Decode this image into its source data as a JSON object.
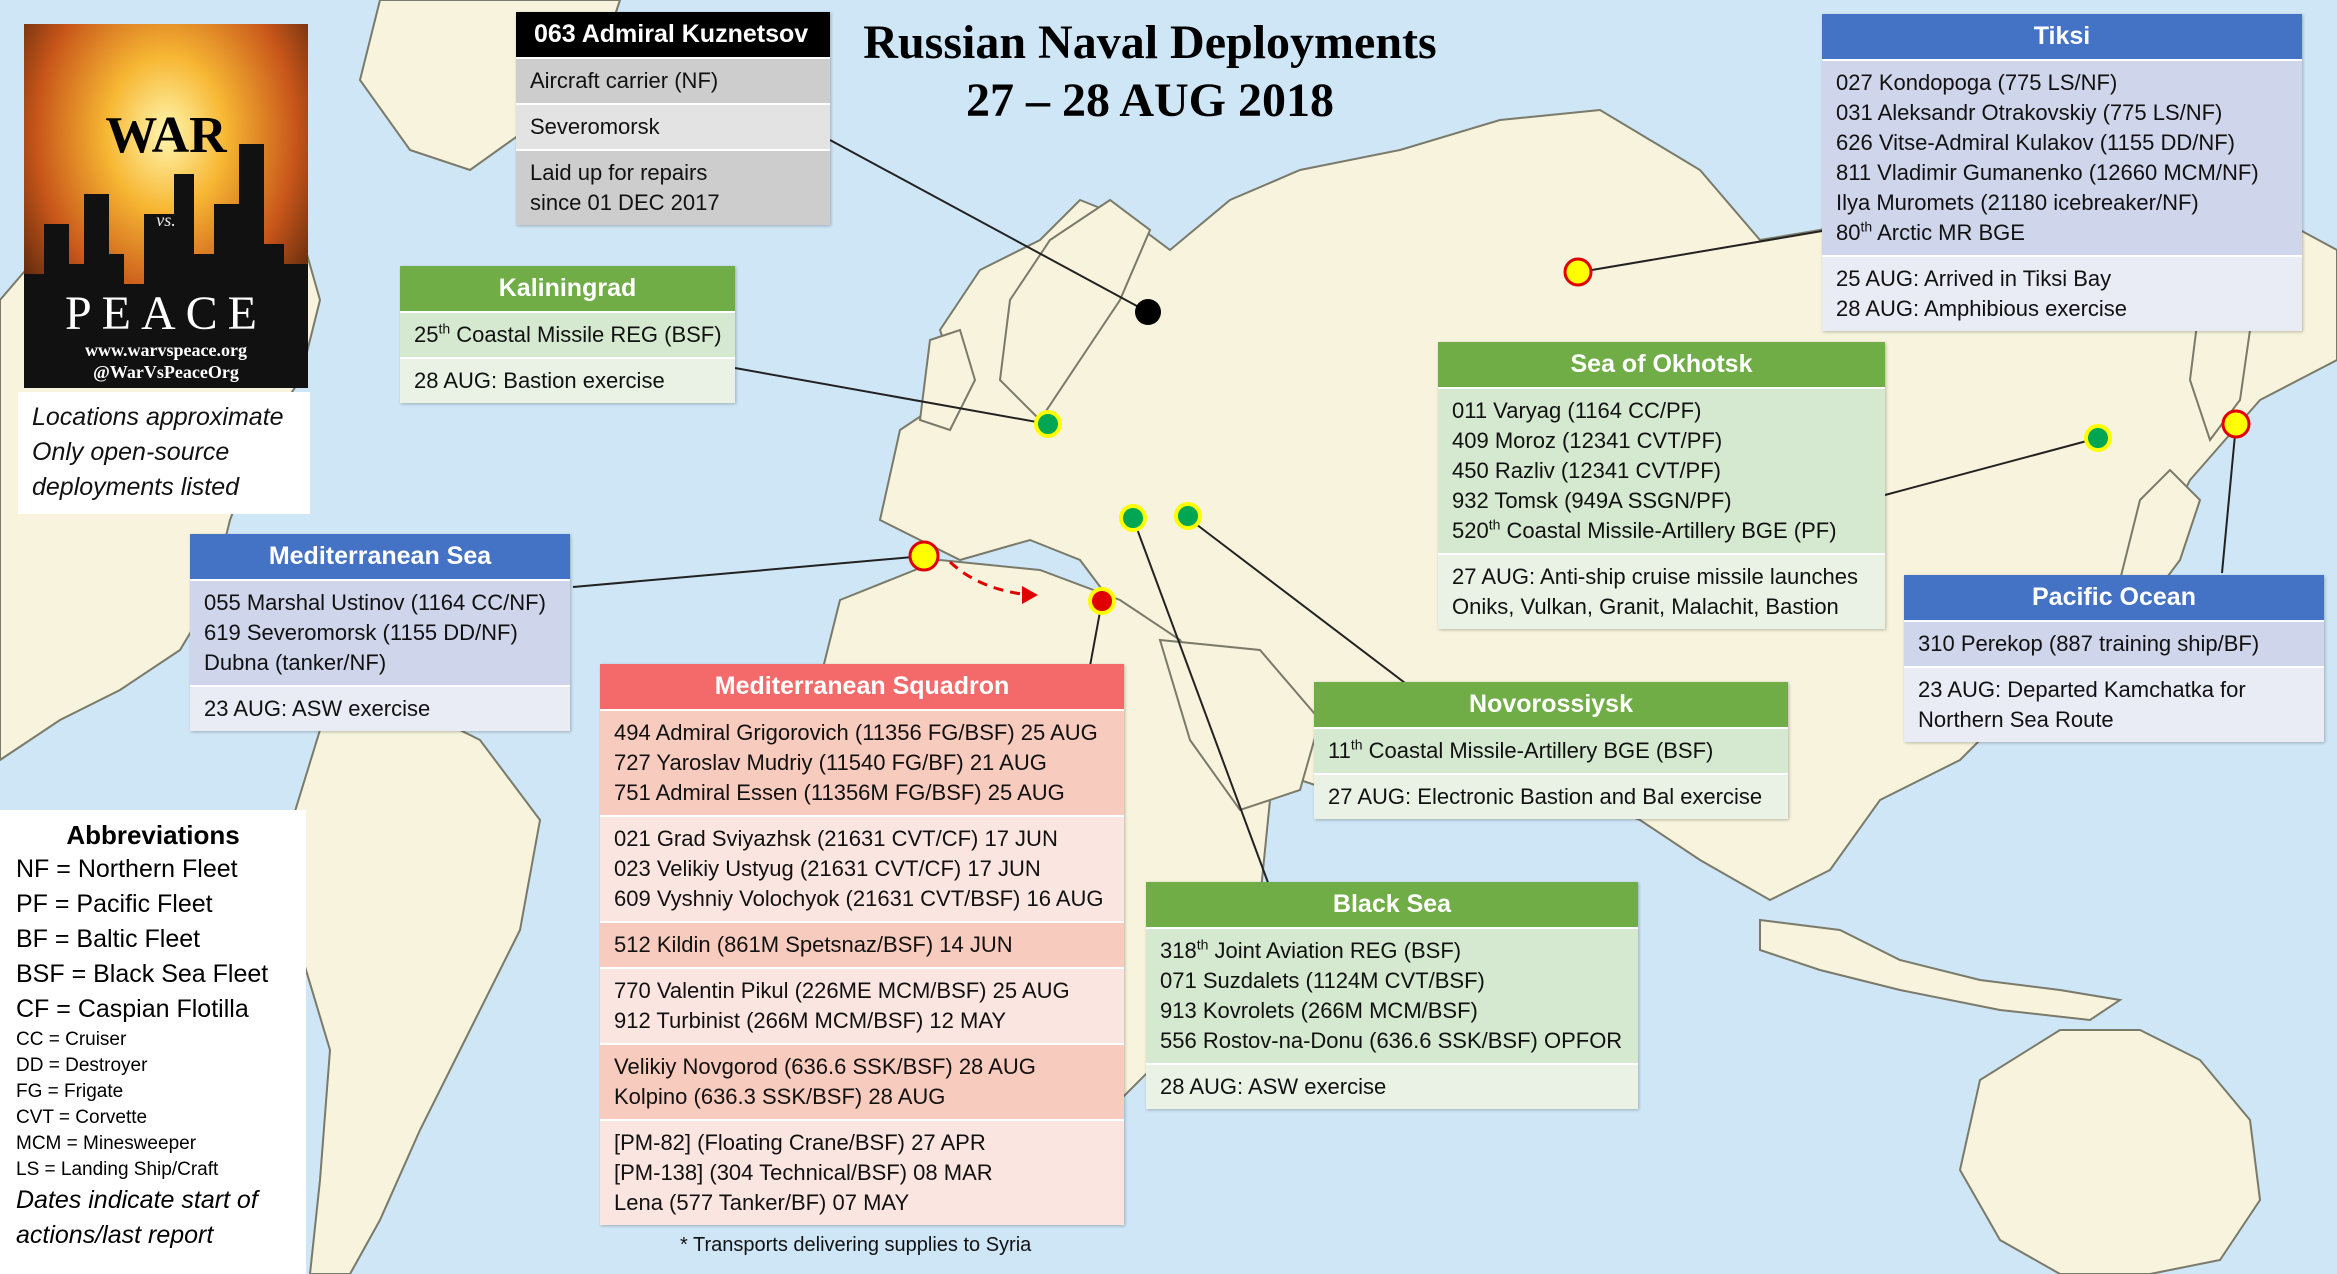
{
  "title": {
    "line1": "Russian Naval Deployments",
    "line2": "27 – 28 AUG 2018"
  },
  "logo": {
    "top_word": "WAR",
    "mid_word": "vs.",
    "bottom_word": "PEACE",
    "url": "www.warvspeace.org",
    "handle": "@WarVsPeaceOrg"
  },
  "note": {
    "line1": "Locations approximate",
    "line2": "Only open-source",
    "line3": "deployments listed"
  },
  "footnote": "* Transports delivering supplies to Syria",
  "abbreviations": {
    "title": "Abbreviations",
    "fleets": [
      "NF = Northern Fleet",
      "PF = Pacific Fleet",
      "BF = Baltic Fleet",
      "BSF = Black Sea Fleet",
      "CF = Caspian Flotilla"
    ],
    "types": [
      "CC = Cruiser",
      "DD = Destroyer",
      "FG = Frigate",
      "CVT = Corvette",
      "MCM = Minesweeper",
      "LS = Landing Ship/Craft"
    ],
    "dates_line1": "Dates indicate start of",
    "dates_line2": "actions/last report"
  },
  "kuznetsov": {
    "header": "063 Admiral Kuznetsov",
    "type": "Aircraft carrier (NF)",
    "location": "Severomorsk",
    "status_line1": "Laid up for repairs",
    "status_line2": "since 01 DEC 2017"
  },
  "kaliningrad": {
    "header": "Kaliningrad",
    "unit_ordinal": "25",
    "unit_suffix": "th",
    "unit_rest": " Coastal Missile REG (BSF)",
    "event": "28 AUG: Bastion exercise"
  },
  "tiksi": {
    "header": "Tiksi",
    "ships": [
      "027 Kondopoga (775 LS/NF)",
      "031 Aleksandr Otrakovskiy (775 LS/NF)",
      "626 Vitse-Admiral Kulakov (1155 DD/NF)",
      "811 Vladimir Gumanenko (12660 MCM/NF)",
      "Ilya Muromets (21180 icebreaker/NF)"
    ],
    "unit_ordinal": "80",
    "unit_suffix": "th",
    "unit_rest": " Arctic MR BGE",
    "events": [
      "25 AUG: Arrived in Tiksi Bay",
      "28 AUG: Amphibious exercise"
    ]
  },
  "okhotsk": {
    "header": "Sea of Okhotsk",
    "ships": [
      "011 Varyag (1164 CC/PF)",
      "409 Moroz (12341 CVT/PF)",
      "450 Razliv (12341 CVT/PF)",
      "932 Tomsk (949A SSGN/PF)"
    ],
    "unit_ordinal": "520",
    "unit_suffix": "th",
    "unit_rest": " Coastal Missile-Artillery BGE (PF)",
    "events": [
      "27 AUG: Anti-ship cruise missile launches",
      "Oniks, Vulkan, Granit, Malachit, Bastion"
    ]
  },
  "pacific": {
    "header": "Pacific Ocean",
    "ship": "310 Perekop (887 training ship/BF)",
    "events": [
      "23 AUG: Departed Kamchatka for",
      "Northern Sea Route"
    ]
  },
  "mediterranean": {
    "header": "Mediterranean Sea",
    "ships": [
      "055 Marshal Ustinov (1164 CC/NF)",
      "619 Severomorsk (1155 DD/NF)",
      "Dubna (tanker/NF)"
    ],
    "event": "23 AUG: ASW exercise"
  },
  "squadron": {
    "header": "Mediterranean Squadron",
    "groups": [
      [
        "494 Admiral Grigorovich (11356 FG/BSF) 25 AUG",
        "727 Yaroslav Mudriy (11540 FG/BF) 21 AUG",
        "751 Admiral Essen (11356M FG/BSF) 25 AUG"
      ],
      [
        "021 Grad Sviyazhsk (21631 CVT/CF) 17 JUN",
        "023 Velikiy Ustyug (21631 CVT/CF) 17 JUN",
        "609 Vyshniy Volochyok (21631 CVT/BSF) 16 AUG"
      ],
      [
        "512 Kildin (861M Spetsnaz/BSF) 14 JUN"
      ],
      [
        "770 Valentin Pikul (226ME MCM/BSF) 25 AUG",
        "912 Turbinist (266M MCM/BSF) 12 MAY"
      ],
      [
        "Velikiy Novgorod (636.6 SSK/BSF) 28 AUG",
        "Kolpino (636.3 SSK/BSF) 28 AUG"
      ],
      [
        "[PM-82] (Floating Crane/BSF) 27 APR",
        "[PM-138] (304 Technical/BSF) 08 MAR",
        "Lena (577 Tanker/BF) 07 MAY"
      ]
    ]
  },
  "novorossiysk": {
    "header": "Novorossiysk",
    "unit_ordinal": "11",
    "unit_suffix": "th",
    "unit_rest": " Coastal Missile-Artillery BGE (BSF)",
    "event": "27 AUG: Electronic Bastion and Bal exercise"
  },
  "blacksea": {
    "header": "Black Sea",
    "unit_ordinal": "318",
    "unit_suffix": "th",
    "unit_rest": " Joint Aviation REG (BSF)",
    "ships": [
      "071 Suzdalets (1124M CVT/BSF)",
      "913 Kovrolets (266M MCM/BSF)",
      "556 Rostov-na-Donu (636.6 SSK/BSF) OPFOR"
    ],
    "event": "28 AUG: ASW exercise"
  },
  "colors": {
    "ocean": "#cfe6f7",
    "land": "#f7f3dc",
    "green_header": "#70ad47",
    "blue_header": "#4472c4",
    "red_header": "#f46a6a",
    "marker_green": "#00a651",
    "marker_yellow": "#ffff00",
    "marker_red": "#ff0000"
  }
}
